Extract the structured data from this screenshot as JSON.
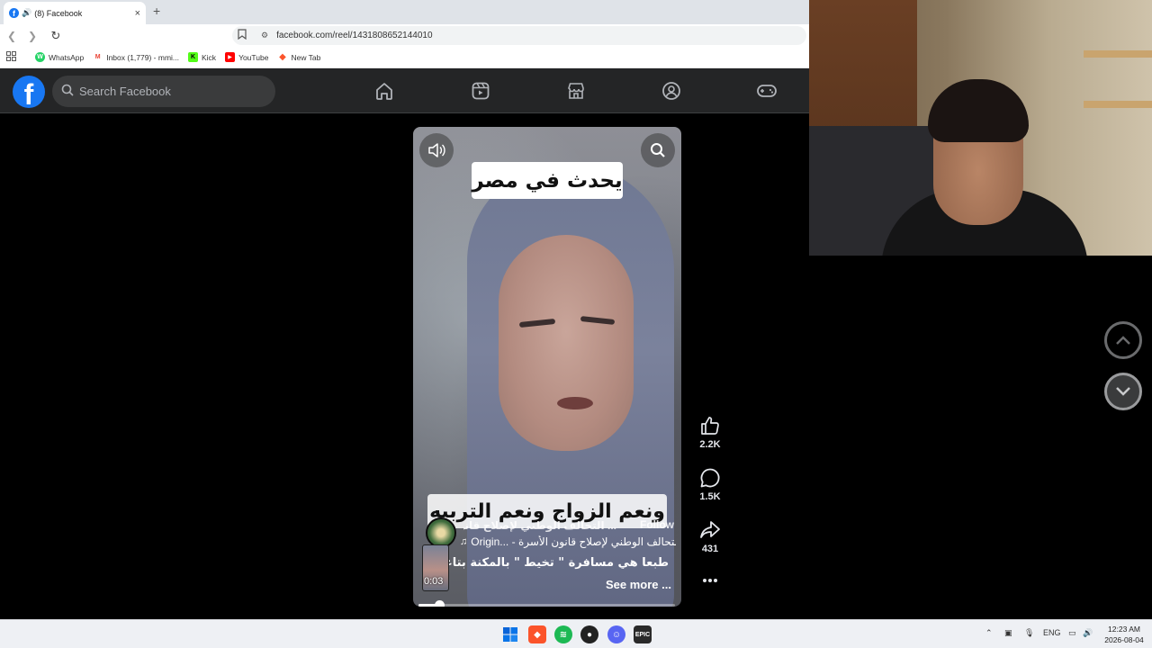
{
  "browser": {
    "tab": {
      "title": "(8) Facebook",
      "close": "×"
    },
    "new_tab": "+",
    "url": "facebook.com/reel/1431808652144010",
    "bookmarks": [
      {
        "label": "WhatsApp",
        "color": "#25d366",
        "glyph": "W"
      },
      {
        "label": "Inbox (1,779) - mmi...",
        "color": "#ea4335",
        "glyph": "M"
      },
      {
        "label": "Kick",
        "color": "#53fc18",
        "glyph": "K"
      },
      {
        "label": "YouTube",
        "color": "#ff0000",
        "glyph": "▶"
      },
      {
        "label": "New Tab",
        "color": "#fb542b",
        "glyph": "◆"
      }
    ]
  },
  "facebook": {
    "logo": "f",
    "search_placeholder": "Search Facebook",
    "nav": [
      "home-icon",
      "reels-icon",
      "marketplace-icon",
      "groups-icon",
      "gaming-icon"
    ],
    "reel": {
      "caption_top": "يحدث في مصر",
      "caption_bottom": "ونعم الزواج ونعم التربيه",
      "page_name": "... التحالف الوطني لإصلاح قانون الأسرة",
      "follow": "Follow",
      "audio": "Origin... - التحالف الوطني لإصلاح قانون الأسرة",
      "thumb_time": "0:03",
      "description": "طبعا هي مسافرة \" تخيط \" بالمكنة بتاعتها",
      "see_more": "See more ...",
      "progress": 0.08
    },
    "actions": {
      "likes": "2.2K",
      "comments": "1.5K",
      "shares": "431"
    }
  },
  "taskbar": {
    "lang": "ENG",
    "time": "12:23 AM",
    "date": "2026-08-04"
  }
}
